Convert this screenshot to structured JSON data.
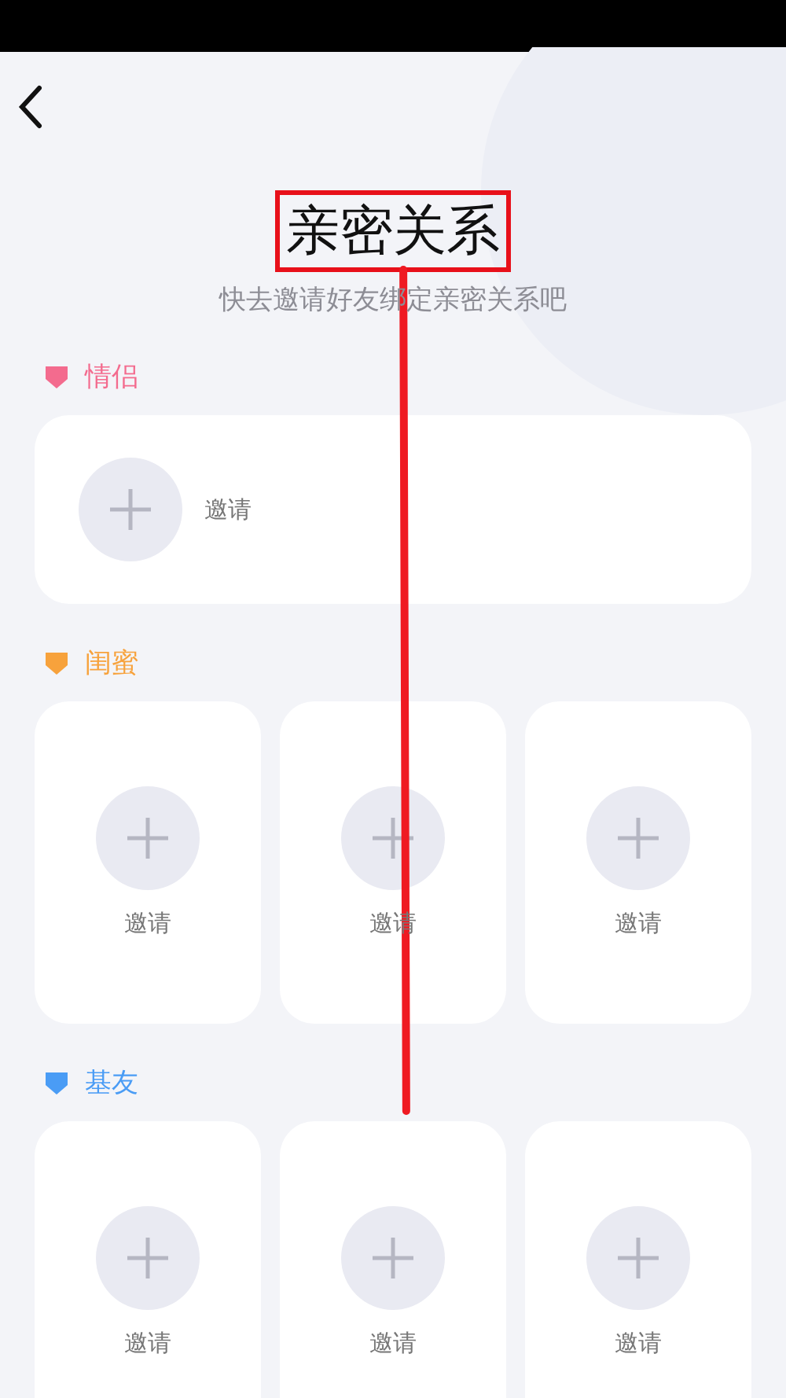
{
  "title": {
    "text": "亲密关系",
    "highlighted": true
  },
  "subtitle": "快去邀请好友绑定亲密关系吧",
  "sections": [
    {
      "label": "情侣",
      "color": "#f36b8e",
      "kind": "wide",
      "slots": [
        {
          "label": "邀请"
        }
      ]
    },
    {
      "label": "闺蜜",
      "color": "#f7a23c",
      "kind": "grid",
      "slots": [
        {
          "label": "邀请"
        },
        {
          "label": "邀请"
        },
        {
          "label": "邀请"
        }
      ]
    },
    {
      "label": "基友",
      "color": "#4a9cf5",
      "kind": "grid",
      "slots": [
        {
          "label": "邀请"
        },
        {
          "label": "邀请"
        },
        {
          "label": "邀请"
        }
      ]
    }
  ]
}
